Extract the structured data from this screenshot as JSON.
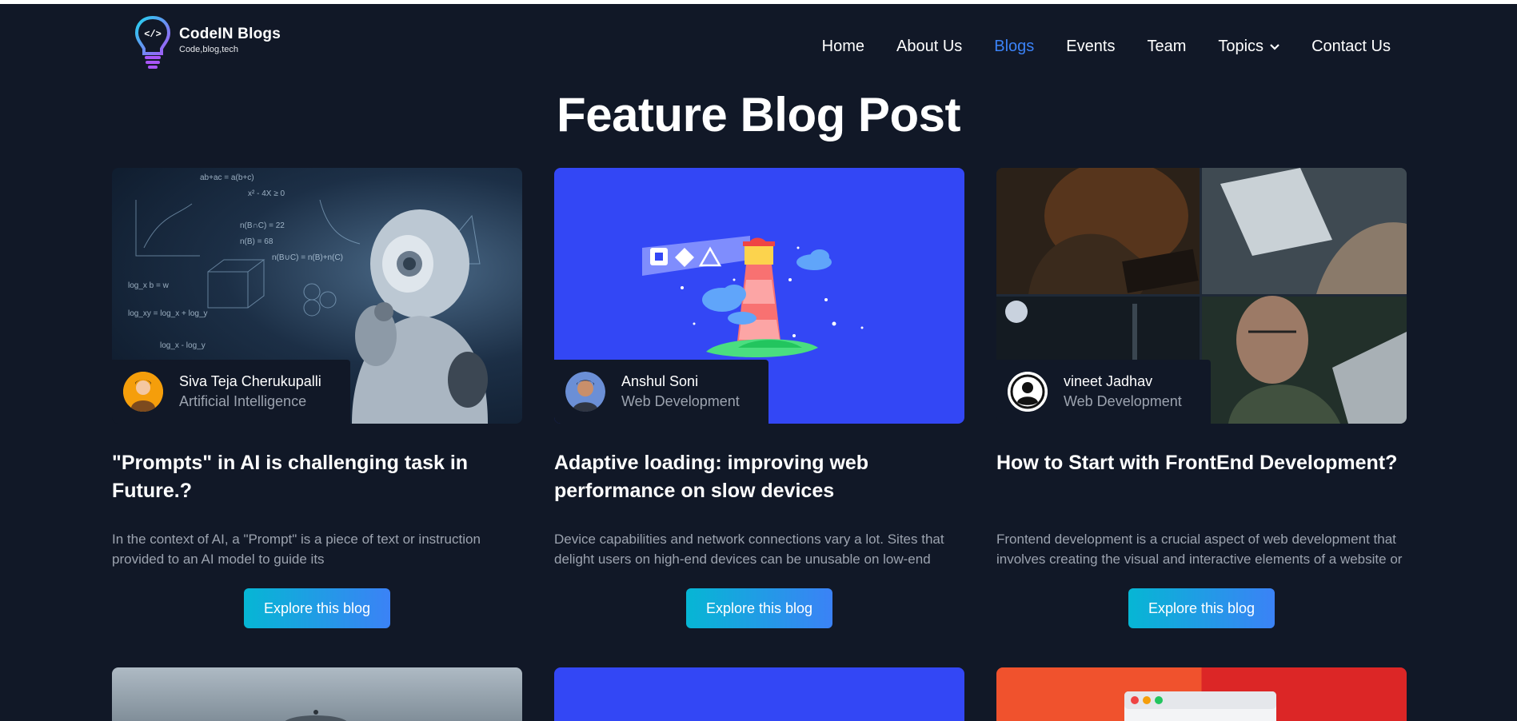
{
  "header": {
    "logo_title": "CodeIN Blogs",
    "logo_tagline": "Code,blog,tech",
    "logo_glyph": "</>",
    "nav": [
      {
        "label": "Home"
      },
      {
        "label": "About Us"
      },
      {
        "label": "Blogs",
        "active": true
      },
      {
        "label": "Events"
      },
      {
        "label": "Team"
      },
      {
        "label": "Topics",
        "has_dropdown": true
      },
      {
        "label": "Contact Us"
      }
    ]
  },
  "page_title": "Feature Blog Post",
  "cards": [
    {
      "author": "Siva Teja Cherukupalli",
      "topic": "Artificial Intelligence",
      "title": "\"Prompts\" in AI is challenging task in Future.?",
      "excerpt": "In the context of AI, a \"Prompt\" is a piece of text or instruction provided to an AI model to guide its",
      "button": "Explore this blog",
      "image": "ai-robot-image"
    },
    {
      "author": "Anshul Soni",
      "topic": "Web Development",
      "title": "Adaptive loading: improving web performance on slow devices",
      "excerpt": "Device capabilities and network connections vary a lot. Sites that delight users on high-end devices can be unusable on low-end",
      "button": "Explore this blog",
      "image": "lighthouse-image"
    },
    {
      "author": "vineet Jadhav",
      "topic": "Web Development",
      "title": "How to Start with FrontEnd Development?",
      "excerpt": "Frontend development is a crucial aspect of web development that involves creating the visual and interactive elements of a website or",
      "button": "Explore this blog",
      "image": "developers-collage-image"
    }
  ],
  "colors": {
    "background": "#111827",
    "accent": "#3b82f6",
    "button_gradient_start": "#06b6d4",
    "button_gradient_end": "#3b82f6",
    "muted_text": "#9ca3af",
    "card2_bg": "#3347f5"
  }
}
